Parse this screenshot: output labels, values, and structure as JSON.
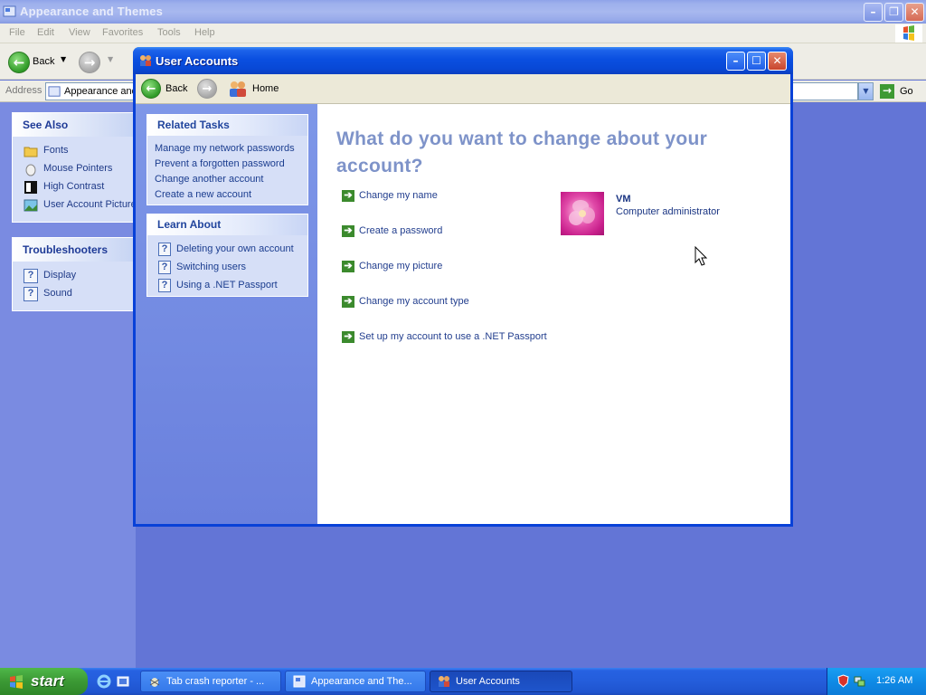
{
  "background_window": {
    "title": "Appearance and Themes",
    "menu": [
      "File",
      "Edit",
      "View",
      "Favorites",
      "Tools",
      "Help"
    ],
    "toolbar": {
      "back_label": "Back"
    },
    "address": {
      "label": "Address",
      "value": "Appearance and",
      "go_label": "Go"
    },
    "see_also": {
      "title": "See Also",
      "items": [
        {
          "label": "Fonts",
          "icon": "folder-icon"
        },
        {
          "label": "Mouse Pointers",
          "icon": "mouse-icon"
        },
        {
          "label": "High Contrast",
          "icon": "contrast-icon"
        },
        {
          "label": "User Account Picture",
          "icon": "picture-icon"
        }
      ]
    },
    "troubleshooters": {
      "title": "Troubleshooters",
      "items": [
        {
          "label": "Display",
          "icon": "help-icon"
        },
        {
          "label": "Sound",
          "icon": "help-icon"
        }
      ]
    }
  },
  "user_accounts": {
    "title": "User Accounts",
    "nav": {
      "back_label": "Back",
      "home_label": "Home"
    },
    "related_tasks": {
      "title": "Related Tasks",
      "items": [
        "Manage my network passwords",
        "Prevent a forgotten password",
        "Change another account",
        "Create a new account"
      ]
    },
    "learn_about": {
      "title": "Learn About",
      "items": [
        "Deleting your own account",
        "Switching users",
        "Using a .NET Passport"
      ]
    },
    "heading": "What do you want to change about your account?",
    "actions": [
      "Change my name",
      "Create a password",
      "Change my picture",
      "Change my account type",
      "Set up my account to use a .NET Passport"
    ],
    "account": {
      "name": "VM",
      "type": "Computer administrator"
    }
  },
  "taskbar": {
    "start_label": "start",
    "tasks": [
      {
        "label": "Tab crash reporter - ...",
        "icon": "bug-icon",
        "active": false
      },
      {
        "label": "Appearance and The...",
        "icon": "control-panel-icon",
        "active": false
      },
      {
        "label": "User Accounts",
        "icon": "users-icon",
        "active": true
      }
    ],
    "clock": "1:26 AM"
  },
  "colors": {
    "xp_blue": "#0841d8",
    "sidebar_blue": "#7e97e8",
    "link_blue": "#223e8e",
    "heading": "#7e93c9",
    "taskbar": "#245ddb",
    "start_green": "#3d9b36"
  }
}
